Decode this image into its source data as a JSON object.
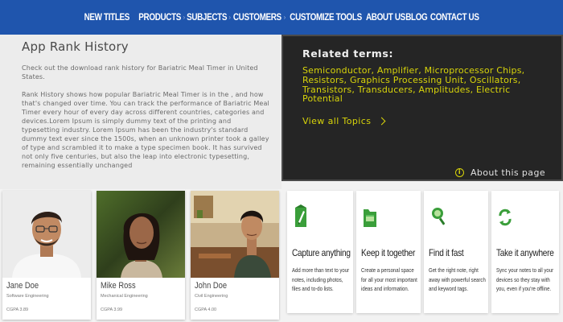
{
  "nav": {
    "items": [
      "NEW TITLES",
      "PRODUCTS",
      "SUBJECTS",
      "CUSTOMERS",
      "CUSTOMIZE TOOLS",
      "ABOUT US",
      "BLOG",
      "CONTACT US"
    ],
    "separator": "›"
  },
  "rank": {
    "title": "App Rank History",
    "paragraph1": "Check out the download rank history for Bariatric Meal Timer in United States.",
    "paragraph2": "Rank History shows how popular Bariatric Meal Timer is in the , and how that's changed over time. You can track the performance of Bariatric Meal Timer every hour of every day across different countries, categories and devices.Lorem Ipsum is simply dummy text of the printing and typesetting industry. Lorem Ipsum has been the industry's standard dummy text ever since the 1500s, when an unknown printer took a galley of type and scrambled it to make a type specimen book. It has survived not only five centuries, but also the leap into electronic typesetting, remaining essentially unchanged"
  },
  "related": {
    "title": "Related terms:",
    "terms": [
      "Semiconductor",
      "Amplifier",
      "Microprocessor Chips",
      "Resistors",
      "Graphics Processing Unit",
      "Oscillators",
      "Transistors",
      "Transducers",
      "Amplitudes",
      "Electric Potential"
    ],
    "view_all": "View all Topics",
    "about": "About this page",
    "accent_color": "#d8d40a"
  },
  "people": [
    {
      "name": "Jane Doe",
      "dept": "Software Engineering",
      "gpa": "CGPA 3.89"
    },
    {
      "name": "Mike Ross",
      "dept": "Mechanical Engineering",
      "gpa": "CGPA 3.99"
    },
    {
      "name": "John Doe",
      "dept": "Civil Engineering",
      "gpa": "CGPA 4.00"
    }
  ],
  "features": [
    {
      "title": "Capture anything",
      "desc": "Add more than text to your notes, including photos, files and to-do lists.",
      "icon": "pen-icon"
    },
    {
      "title": "Keep it together",
      "desc": "Create a personal space for all your most important ideas and information.",
      "icon": "folder-icon"
    },
    {
      "title": "Find it fast",
      "desc": "Get the right note, right away with powerful search and keyword tags.",
      "icon": "search-icon"
    },
    {
      "title": "Take it anywhere",
      "desc": "Sync your notes to all your devices so they stay with you, even if you're offline.",
      "icon": "sync-icon"
    }
  ]
}
